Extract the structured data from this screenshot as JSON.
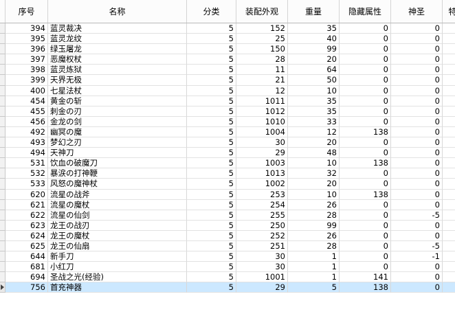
{
  "columns": [
    "序号",
    "名称",
    "分类",
    "装配外观",
    "重量",
    "隐藏属性",
    "神圣",
    "特"
  ],
  "rows": [
    [
      "394",
      "蓝灵裁决",
      "5",
      "152",
      "35",
      "0",
      "0",
      ""
    ],
    [
      "395",
      "蓝灵龙纹",
      "5",
      "25",
      "40",
      "0",
      "0",
      ""
    ],
    [
      "396",
      "绿玉屠龙",
      "5",
      "150",
      "99",
      "0",
      "0",
      ""
    ],
    [
      "397",
      "恶魔权杖",
      "5",
      "28",
      "20",
      "0",
      "0",
      ""
    ],
    [
      "398",
      "蓝灵炼狱",
      "5",
      "11",
      "64",
      "0",
      "0",
      ""
    ],
    [
      "399",
      "天界无极",
      "5",
      "21",
      "50",
      "0",
      "0",
      ""
    ],
    [
      "400",
      "七星法杖",
      "5",
      "12",
      "10",
      "0",
      "0",
      ""
    ],
    [
      "454",
      "黄金の斩",
      "5",
      "1011",
      "35",
      "0",
      "0",
      ""
    ],
    [
      "455",
      "刺金の刃",
      "5",
      "1012",
      "35",
      "0",
      "0",
      ""
    ],
    [
      "456",
      "金龙の剑",
      "5",
      "1010",
      "33",
      "0",
      "0",
      ""
    ],
    [
      "492",
      "幽冥の魔",
      "5",
      "1004",
      "12",
      "138",
      "0",
      ""
    ],
    [
      "493",
      "梦幻之刃",
      "5",
      "30",
      "20",
      "0",
      "0",
      ""
    ],
    [
      "494",
      "天神刀",
      "5",
      "29",
      "48",
      "0",
      "0",
      ""
    ],
    [
      "531",
      "饮血の破魔刀",
      "5",
      "1003",
      "10",
      "138",
      "0",
      ""
    ],
    [
      "532",
      "暴涙の打神鞭",
      "5",
      "1013",
      "32",
      "0",
      "0",
      ""
    ],
    [
      "533",
      "风怒の魔神杖",
      "5",
      "1002",
      "20",
      "0",
      "0",
      ""
    ],
    [
      "620",
      "流星の战斧",
      "5",
      "253",
      "10",
      "138",
      "0",
      ""
    ],
    [
      "621",
      "流星の魔杖",
      "5",
      "254",
      "26",
      "0",
      "0",
      ""
    ],
    [
      "622",
      "流星の仙剑",
      "5",
      "255",
      "28",
      "0",
      "-5",
      ""
    ],
    [
      "623",
      "龙王の战刃",
      "5",
      "250",
      "99",
      "0",
      "0",
      ""
    ],
    [
      "624",
      "龙王の魔杖",
      "5",
      "252",
      "26",
      "0",
      "0",
      ""
    ],
    [
      "625",
      "龙王の仙扇",
      "5",
      "251",
      "28",
      "0",
      "-5",
      ""
    ],
    [
      "644",
      "新手刀",
      "5",
      "30",
      "1",
      "0",
      "-1",
      ""
    ],
    [
      "681",
      "小红刀",
      "5",
      "30",
      "1",
      "0",
      "0",
      ""
    ],
    [
      "694",
      "圣战之光(经验)",
      "5",
      "1001",
      "1",
      "141",
      "0",
      ""
    ],
    [
      "756",
      "首充神器",
      "5",
      "29",
      "5",
      "138",
      "0",
      ""
    ]
  ],
  "active_row_index": 25
}
